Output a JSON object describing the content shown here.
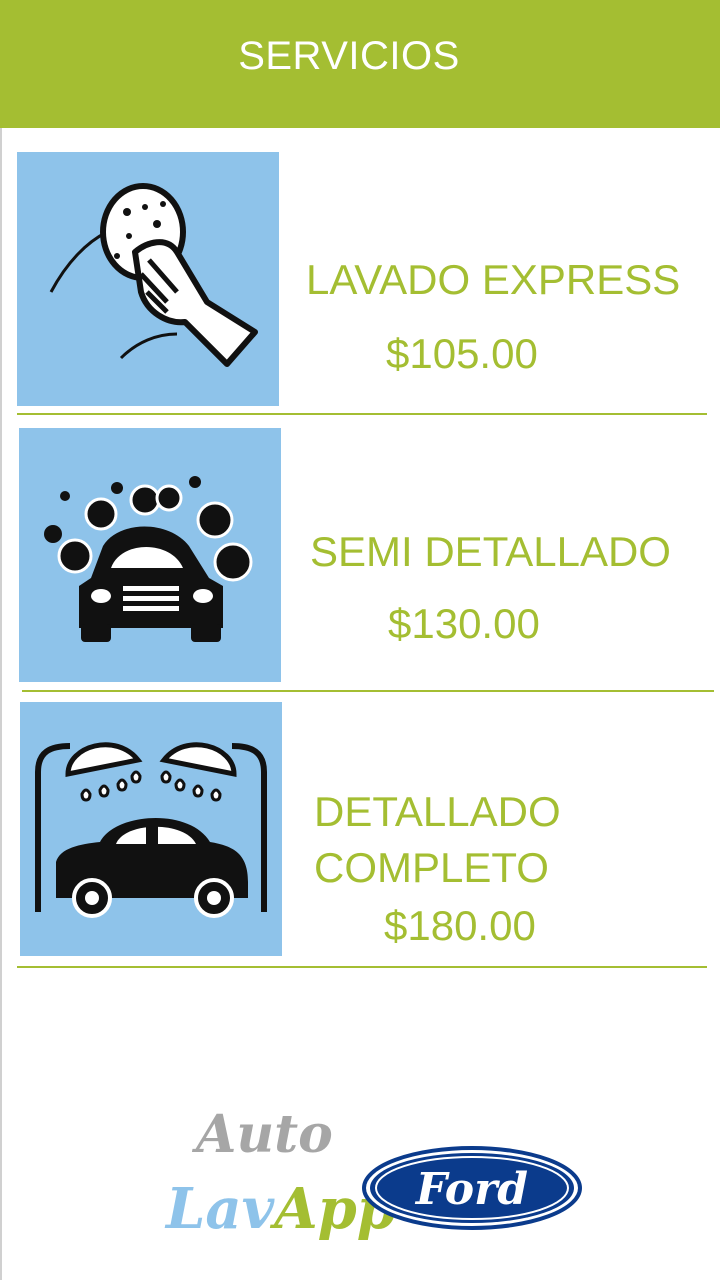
{
  "header": {
    "title": "SERVICIOS"
  },
  "services": [
    {
      "name": "LAVADO EXPRESS",
      "price": "$105.00",
      "icon": "sponge-hand-icon"
    },
    {
      "name": "SEMI DETALLADO",
      "price": "$130.00",
      "icon": "car-bubbles-icon"
    },
    {
      "name": "DETALLADO\nCOMPLETO",
      "price": "$180.00",
      "icon": "car-shower-icon"
    }
  ],
  "footer": {
    "logo_line1": "Auto",
    "logo_line2_a": "Lav",
    "logo_line2_b": "App",
    "brand": "Ford"
  },
  "colors": {
    "accent": "#a4be32",
    "tile": "#8ec3ea",
    "logo_gray": "#a6a6a6"
  }
}
